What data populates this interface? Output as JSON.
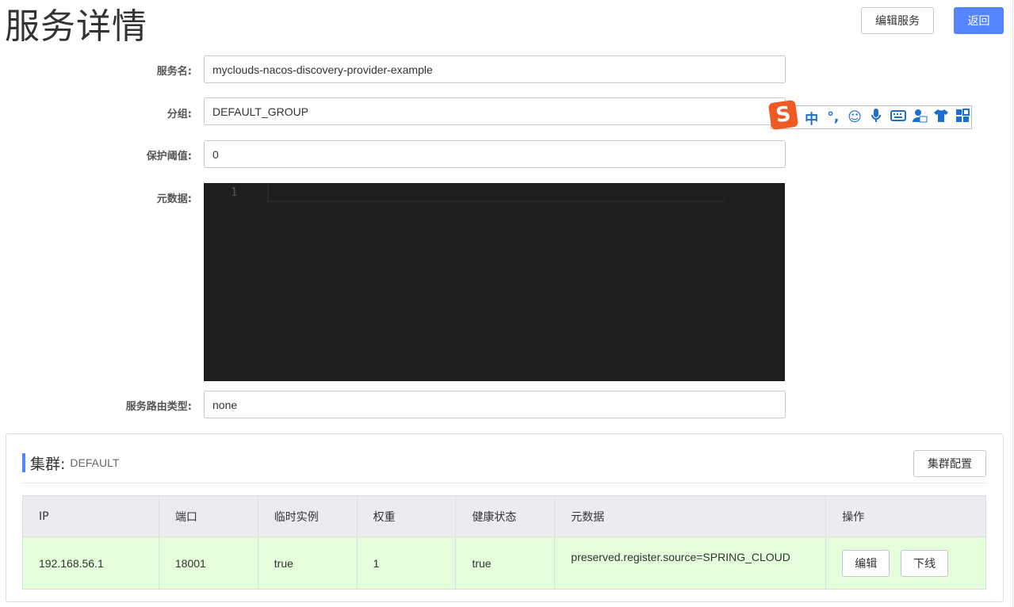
{
  "header": {
    "title": "服务详情",
    "edit_service_label": "编辑服务",
    "back_label": "返回"
  },
  "form": {
    "service_name": {
      "label": "服务名:",
      "value": "myclouds-nacos-discovery-provider-example"
    },
    "group": {
      "label": "分组:",
      "value": "DEFAULT_GROUP"
    },
    "protect_threshold": {
      "label": "保护阈值:",
      "value": "0"
    },
    "metadata": {
      "label": "元数据:",
      "line_number": "1",
      "content": ""
    },
    "selector_type": {
      "label": "服务路由类型:",
      "value": "none"
    }
  },
  "ime_toolbar": {
    "logo": "S",
    "items": [
      {
        "icon": "chinese-mode-icon",
        "glyph": "中"
      },
      {
        "icon": "punctuation-icon",
        "glyph": "°,"
      },
      {
        "icon": "emoji-icon",
        "glyph": "☺"
      },
      {
        "icon": "microphone-icon",
        "glyph": "🎤"
      },
      {
        "icon": "keyboard-icon",
        "glyph": "⌨"
      },
      {
        "icon": "user-icon",
        "glyph": "👤"
      },
      {
        "icon": "skin-icon",
        "glyph": "👕"
      },
      {
        "icon": "toolbox-icon",
        "glyph": "▦"
      }
    ]
  },
  "cluster": {
    "title": "集群:",
    "name": "DEFAULT",
    "config_label": "集群配置",
    "columns": [
      "IP",
      "端口",
      "临时实例",
      "权重",
      "健康状态",
      "元数据",
      "操作"
    ],
    "rows": [
      {
        "ip": "192.168.56.1",
        "port": "18001",
        "ephemeral": "true",
        "weight": "1",
        "healthy": "true",
        "metadata": "preserved.register.source=SPRING_CLOUD",
        "actions": {
          "edit_label": "编辑",
          "offline_label": "下线"
        }
      }
    ]
  },
  "colors": {
    "primary": "#5584ff",
    "row_highlight": "#e4fdda",
    "editor_bg": "#1e1e1e",
    "table_header": "#ebecf0"
  }
}
